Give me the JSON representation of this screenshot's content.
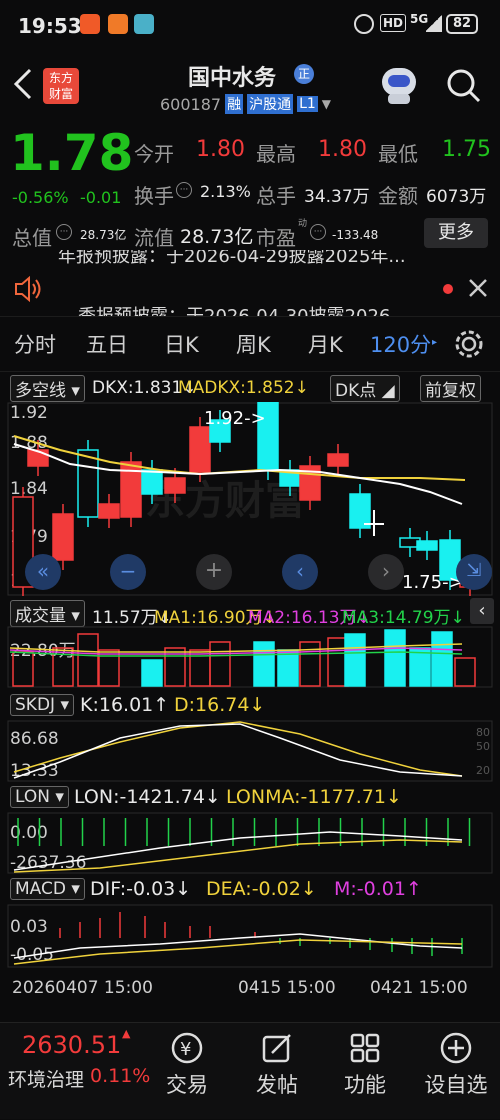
{
  "status": {
    "time": "19:53",
    "battery": "82",
    "network": "5G"
  },
  "header": {
    "logo_line1": "东方",
    "logo_line2": "财富",
    "stock_name": "国中水务",
    "stock_name_badge": "正",
    "stock_code": "600187",
    "tag_rong": "融",
    "tag_hgt": "沪股通",
    "tag_l1": "L1"
  },
  "quote": {
    "price": "1.78",
    "change_pct": "-0.56%",
    "change": "-0.01",
    "open_label": "今开",
    "open": "1.80",
    "high_label": "最高",
    "high": "1.80",
    "low_label": "最低",
    "low": "1.75",
    "turnover_label": "换手",
    "turnover": "2.13%",
    "volume_label": "总手",
    "volume": "34.37万",
    "amount_label": "金额",
    "amount": "6073万",
    "total_mv_label": "总值",
    "total_mv": "28.73亿",
    "float_mv_label": "流值",
    "float_mv": "28.73亿",
    "pe_label": "市盈",
    "pe_sup": "动",
    "pe": "-133.48",
    "more": "更多"
  },
  "news": {
    "line1": "年报预披露：于2026-04-29披露2025年...",
    "line2": "季报预披露：于2026-04-30披露2026..."
  },
  "tabs": [
    "分时",
    "五日",
    "日K",
    "周K",
    "月K",
    "120分"
  ],
  "kline": {
    "indicator": "多空线",
    "dkx": "DKX:1.831↓",
    "madkx": "MADKX:1.852↓",
    "dk_button": "DK点",
    "adjust_button": "前复权",
    "y_labels": [
      "1.92",
      "1.88",
      "1.84",
      "1.79",
      "1.75"
    ],
    "high_callout": "1.92->",
    "low_callout": "1.75->",
    "watermark": "东方财富"
  },
  "volume": {
    "name": "成交量",
    "v": "11.57万↓",
    "ma1": "MA1:16.90万↓",
    "ma2": "MA2:16.13万↓",
    "ma3": "MA3:14.79万↓",
    "y_label": "22.80万"
  },
  "skdj": {
    "name": "SKDJ",
    "k": "K:16.01↑",
    "d": "D:16.74↓",
    "y1": "86.68",
    "y2": "13.33",
    "r1": "80",
    "r2": "50",
    "r3": "20"
  },
  "lon": {
    "name": "LON",
    "lon": "LON:-1421.74↓",
    "lonma": "LONMA:-1177.71↓",
    "y1": "0.00",
    "y2": "-2637.36"
  },
  "macd": {
    "name": "MACD",
    "dif": "DIF:-0.03↓",
    "dea": "DEA:-0.02↓",
    "m": "M:-0.01↑",
    "y1": "0.03",
    "y2": "-0.05"
  },
  "dates": [
    "20260407 15:00",
    "0415 15:00",
    "0421 15:00"
  ],
  "bottom": {
    "index_value": "2630.51",
    "index_name": "环境治理",
    "index_change": "0.11%",
    "trade": "交易",
    "post": "发帖",
    "functions": "功能",
    "settings": "设自选"
  }
}
